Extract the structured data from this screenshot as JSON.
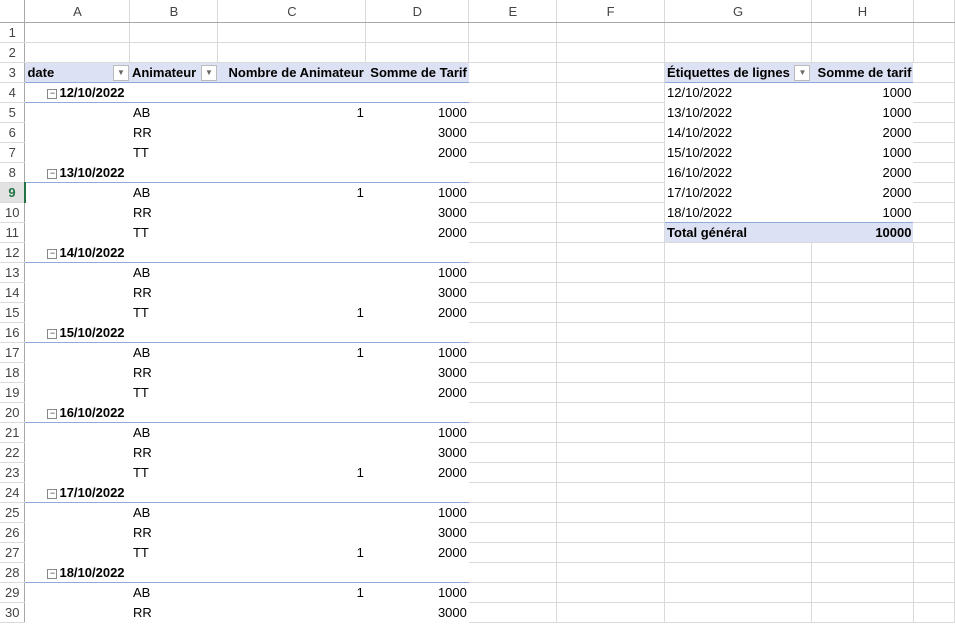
{
  "sheet": {
    "columns": [
      "A",
      "B",
      "C",
      "D",
      "E",
      "F",
      "G",
      "H"
    ],
    "selected_row": 9,
    "rows": [
      [
        "",
        "",
        "",
        "",
        "",
        "",
        "",
        ""
      ],
      [
        "",
        "",
        "",
        "",
        "",
        "",
        "",
        ""
      ],
      [
        "date",
        "Animateur",
        "Nombre de Animateur",
        "Somme de Tarif",
        "",
        "",
        "Étiquettes de lignes",
        "Somme de tarif"
      ],
      [
        "12/10/2022",
        "",
        "",
        "",
        "",
        "",
        "12/10/2022",
        "1000"
      ],
      [
        "",
        "AB",
        "1",
        "1000",
        "",
        "",
        "13/10/2022",
        "1000"
      ],
      [
        "",
        "RR",
        "",
        "3000",
        "",
        "",
        "14/10/2022",
        "2000"
      ],
      [
        "",
        "TT",
        "",
        "2000",
        "",
        "",
        "15/10/2022",
        "1000"
      ],
      [
        "13/10/2022",
        "",
        "",
        "",
        "",
        "",
        "16/10/2022",
        "2000"
      ],
      [
        "",
        "AB",
        "1",
        "1000",
        "",
        "",
        "17/10/2022",
        "2000"
      ],
      [
        "",
        "RR",
        "",
        "3000",
        "",
        "",
        "18/10/2022",
        "1000"
      ],
      [
        "",
        "TT",
        "",
        "2000",
        "",
        "",
        "Total général",
        "10000"
      ],
      [
        "14/10/2022",
        "",
        "",
        "",
        "",
        "",
        "",
        ""
      ],
      [
        "",
        "AB",
        "",
        "1000",
        "",
        "",
        "",
        ""
      ],
      [
        "",
        "RR",
        "",
        "3000",
        "",
        "",
        "",
        ""
      ],
      [
        "",
        "TT",
        "1",
        "2000",
        "",
        "",
        "",
        ""
      ],
      [
        "15/10/2022",
        "",
        "",
        "",
        "",
        "",
        "",
        ""
      ],
      [
        "",
        "AB",
        "1",
        "1000",
        "",
        "",
        "",
        ""
      ],
      [
        "",
        "RR",
        "",
        "3000",
        "",
        "",
        "",
        ""
      ],
      [
        "",
        "TT",
        "",
        "2000",
        "",
        "",
        "",
        ""
      ],
      [
        "16/10/2022",
        "",
        "",
        "",
        "",
        "",
        "",
        ""
      ],
      [
        "",
        "AB",
        "",
        "1000",
        "",
        "",
        "",
        ""
      ],
      [
        "",
        "RR",
        "",
        "3000",
        "",
        "",
        "",
        ""
      ],
      [
        "",
        "TT",
        "1",
        "2000",
        "",
        "",
        "",
        ""
      ],
      [
        "17/10/2022",
        "",
        "",
        "",
        "",
        "",
        "",
        ""
      ],
      [
        "",
        "AB",
        "",
        "1000",
        "",
        "",
        "",
        ""
      ],
      [
        "",
        "RR",
        "",
        "3000",
        "",
        "",
        "",
        ""
      ],
      [
        "",
        "TT",
        "1",
        "2000",
        "",
        "",
        "",
        ""
      ],
      [
        "18/10/2022",
        "",
        "",
        "",
        "",
        "",
        "",
        ""
      ],
      [
        "",
        "AB",
        "1",
        "1000",
        "",
        "",
        "",
        ""
      ],
      [
        "",
        "RR",
        "",
        "3000",
        "",
        "",
        "",
        ""
      ]
    ],
    "row_numbers": [
      "1",
      "2",
      "3",
      "4",
      "5",
      "6",
      "7",
      "8",
      "9",
      "10",
      "11",
      "12",
      "13",
      "14",
      "15",
      "16",
      "17",
      "18",
      "19",
      "20",
      "21",
      "22",
      "23",
      "24",
      "25",
      "26",
      "27",
      "28",
      "29",
      "30"
    ]
  },
  "colors": {
    "pivot_header": "#dce1f3",
    "pivot_line": "#8ea9db",
    "selection": "#217346"
  }
}
